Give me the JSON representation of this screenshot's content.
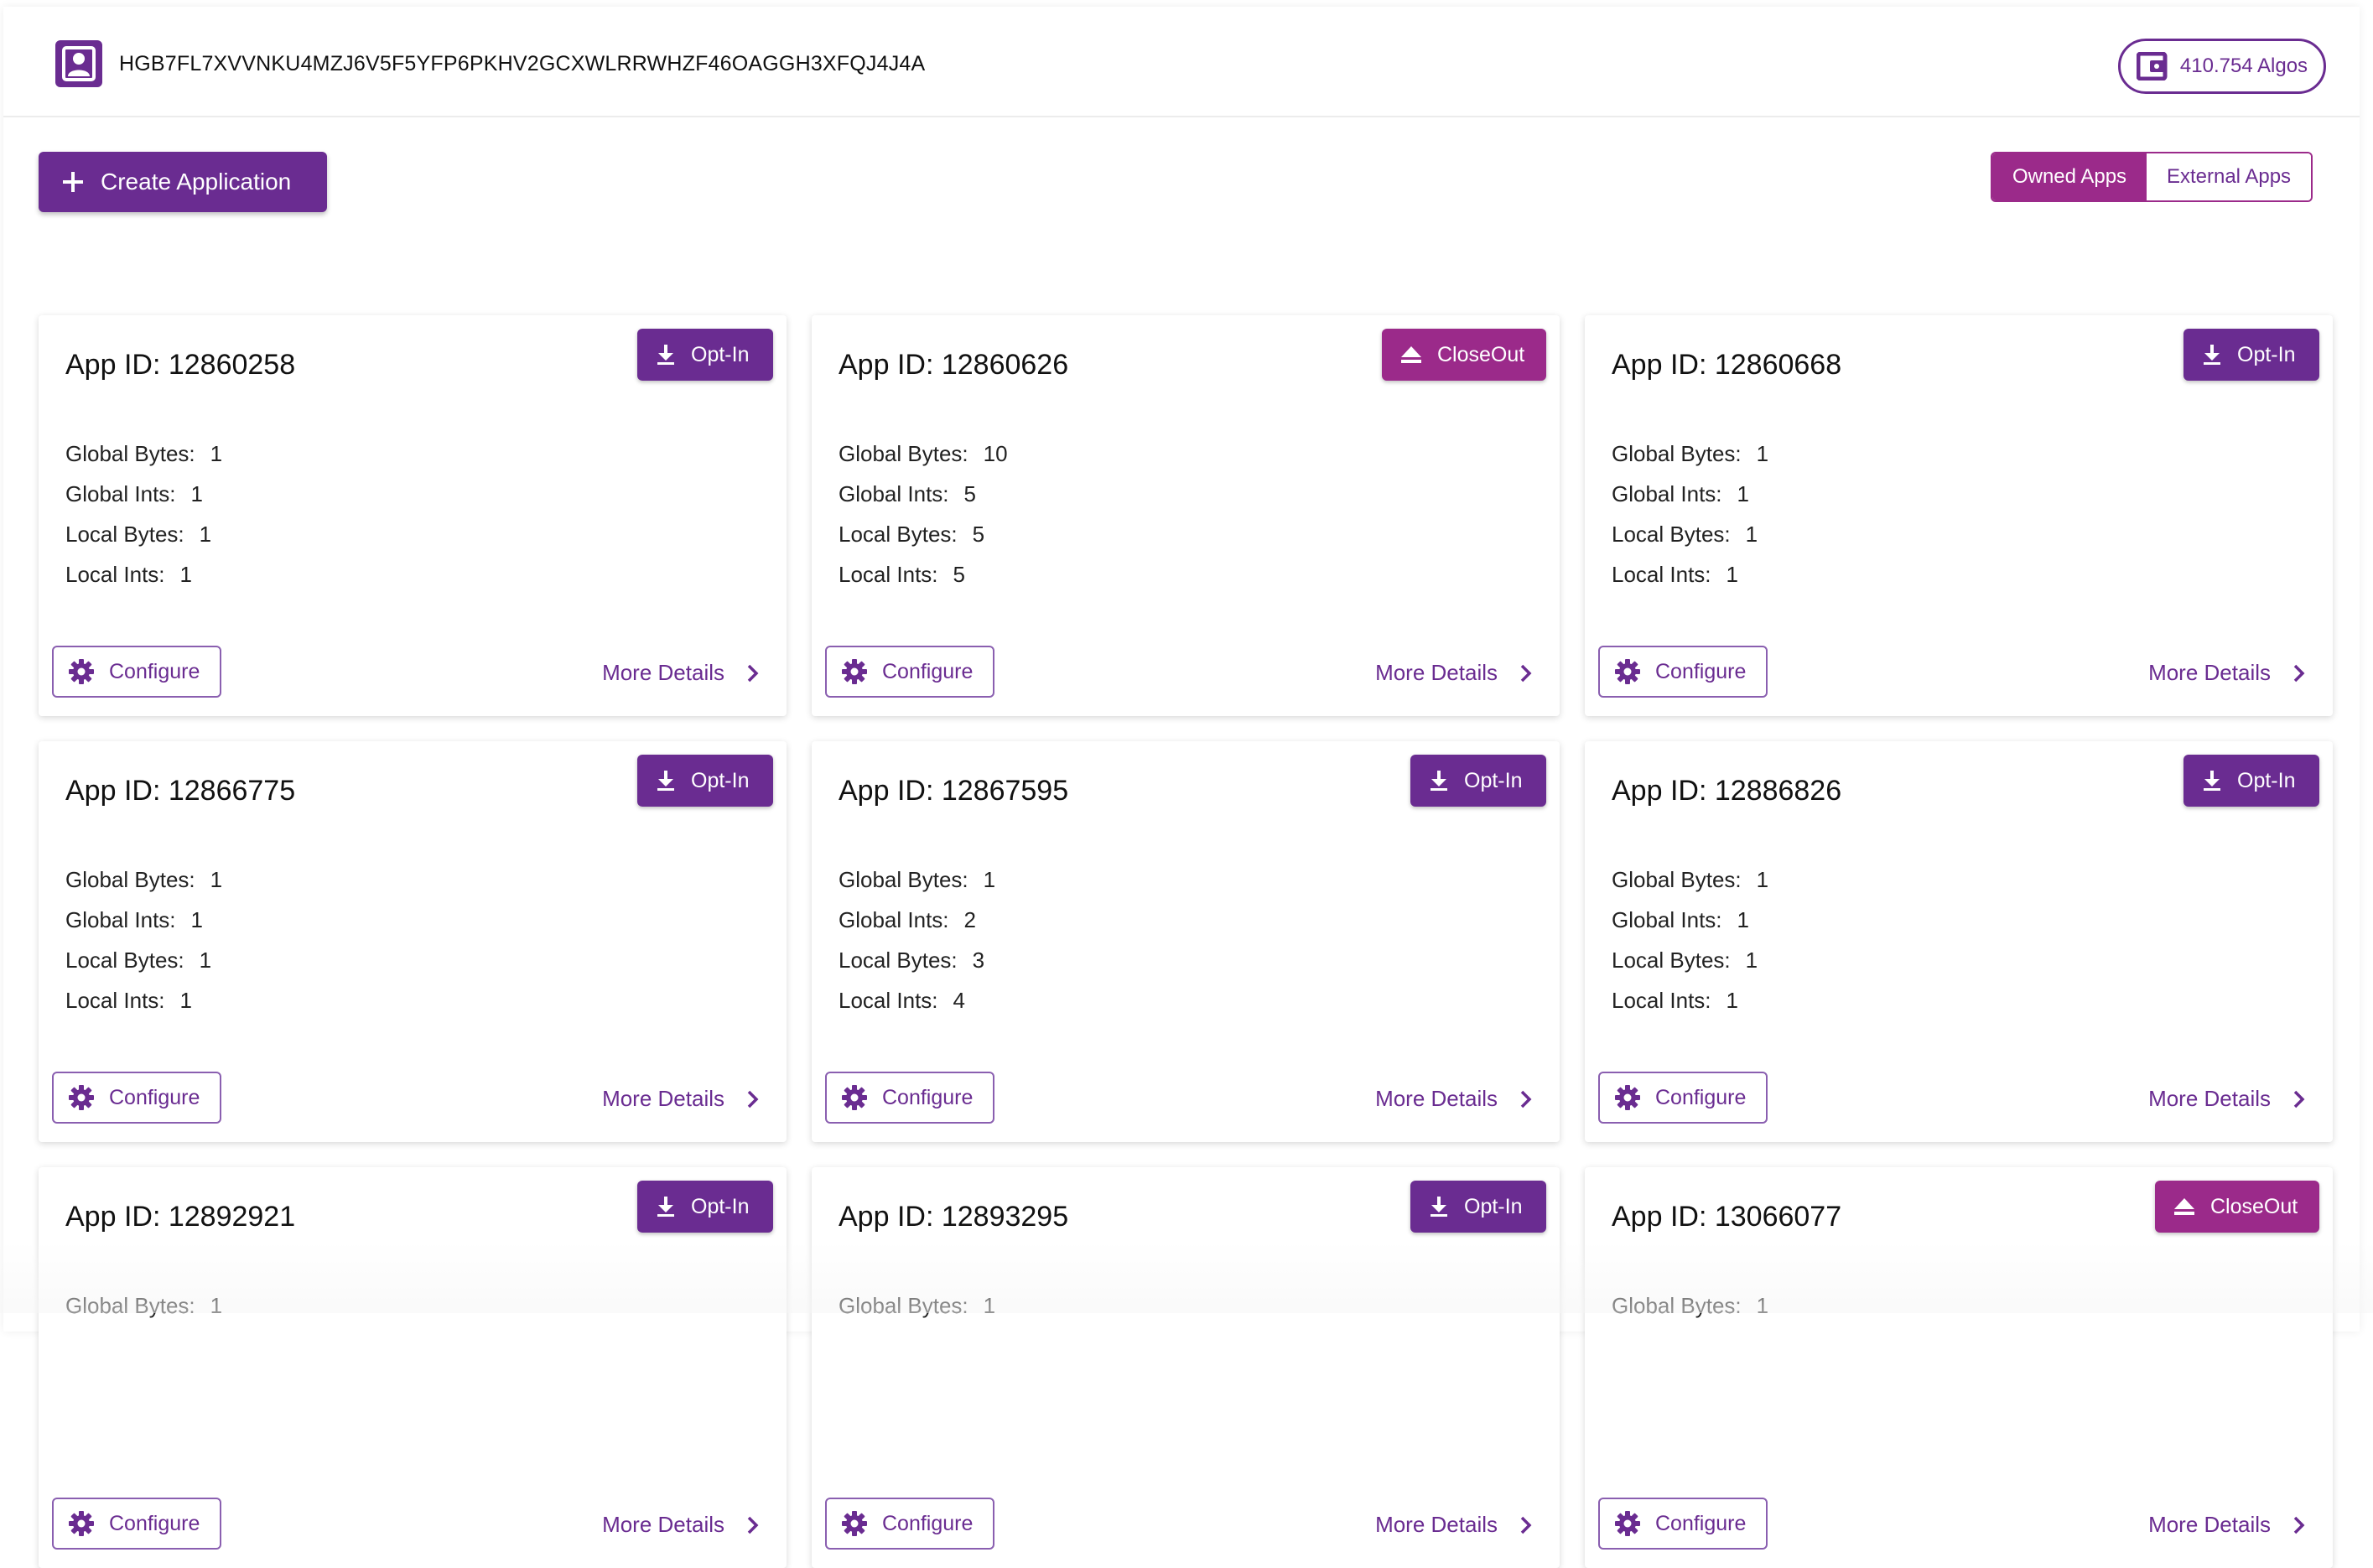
{
  "header": {
    "account_address": "HGB7FL7XVVNKU4MZJ6V5F5YFP6PKHV2GCXWLRRWHZF46OAGGH3XFQJ4J4A",
    "balance": "410.754 Algos"
  },
  "toolbar": {
    "create_label": "Create Application",
    "tabs": [
      {
        "label": "Owned Apps",
        "active": true
      },
      {
        "label": "External Apps",
        "active": false
      }
    ]
  },
  "labels": {
    "global_bytes": "Global Bytes:",
    "global_ints": "Global Ints:",
    "local_bytes": "Local Bytes:",
    "local_ints": "Local Ints:",
    "configure": "Configure",
    "more_details": "More Details"
  },
  "apps": [
    {
      "id_label": "App ID: 12860258",
      "action": "Opt-In",
      "action_type": "optin",
      "global_bytes": "1",
      "global_ints": "1",
      "local_bytes": "1",
      "local_ints": "1"
    },
    {
      "id_label": "App ID: 12860626",
      "action": "CloseOut",
      "action_type": "closeout",
      "global_bytes": "10",
      "global_ints": "5",
      "local_bytes": "5",
      "local_ints": "5"
    },
    {
      "id_label": "App ID: 12860668",
      "action": "Opt-In",
      "action_type": "optin",
      "global_bytes": "1",
      "global_ints": "1",
      "local_bytes": "1",
      "local_ints": "1"
    },
    {
      "id_label": "App ID: 12866775",
      "action": "Opt-In",
      "action_type": "optin",
      "global_bytes": "1",
      "global_ints": "1",
      "local_bytes": "1",
      "local_ints": "1"
    },
    {
      "id_label": "App ID: 12867595",
      "action": "Opt-In",
      "action_type": "optin",
      "global_bytes": "1",
      "global_ints": "2",
      "local_bytes": "3",
      "local_ints": "4"
    },
    {
      "id_label": "App ID: 12886826",
      "action": "Opt-In",
      "action_type": "optin",
      "global_bytes": "1",
      "global_ints": "1",
      "local_bytes": "1",
      "local_ints": "1"
    },
    {
      "id_label": "App ID: 12892921",
      "action": "Opt-In",
      "action_type": "optin",
      "global_bytes": "1"
    },
    {
      "id_label": "App ID: 12893295",
      "action": "Opt-In",
      "action_type": "optin",
      "global_bytes": "1"
    },
    {
      "id_label": "App ID: 13066077",
      "action": "CloseOut",
      "action_type": "closeout",
      "global_bytes": "1"
    }
  ],
  "colors": {
    "primary": "#6a2c91",
    "accent": "#9b2a8a"
  }
}
